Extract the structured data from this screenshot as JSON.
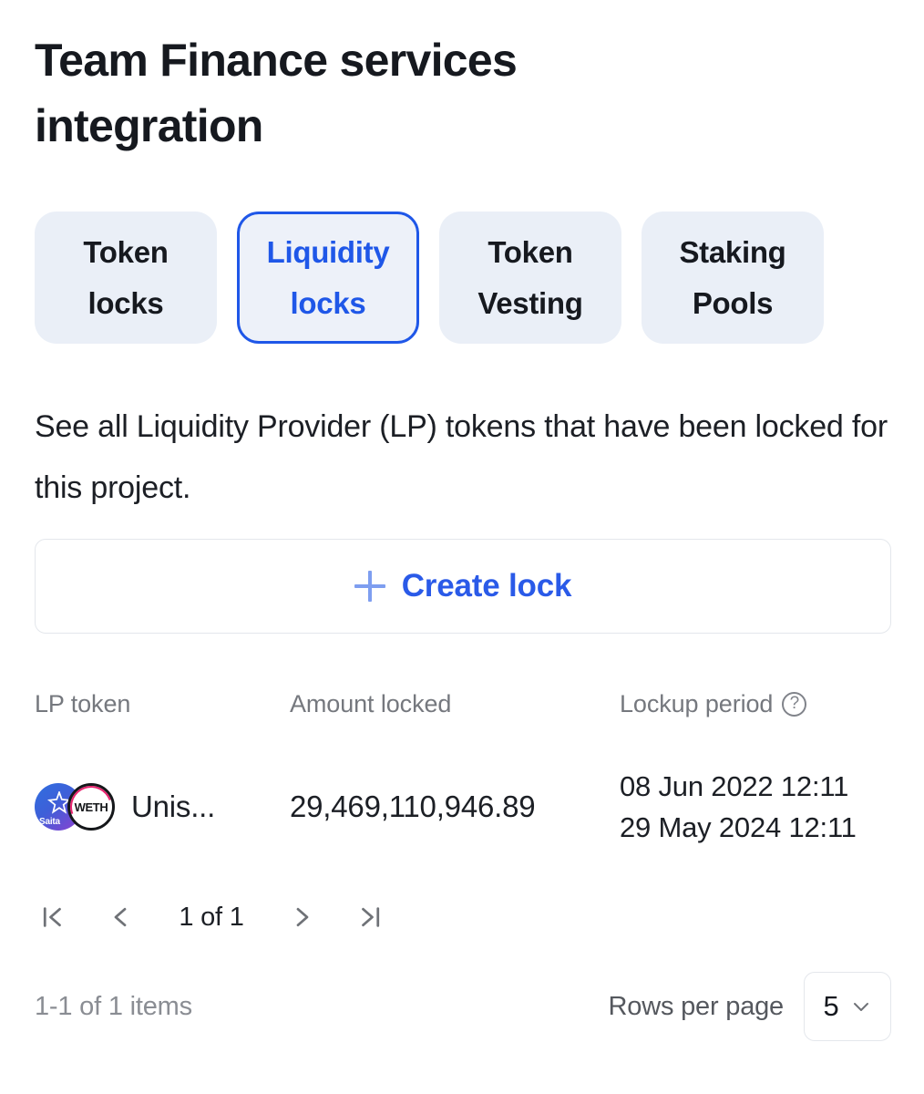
{
  "header": {
    "title": "Team Finance services integration"
  },
  "tabs": [
    {
      "label": "Token locks",
      "name": "tab-token-locks",
      "active": false
    },
    {
      "label": "Liquidity locks",
      "name": "tab-liquidity-locks",
      "active": true
    },
    {
      "label": "Token Vesting",
      "name": "tab-token-vesting",
      "active": false
    },
    {
      "label": "Staking Pools",
      "name": "tab-staking-pools",
      "active": false
    }
  ],
  "description": "See all Liquidity Provider (LP) tokens that have been locked for this project.",
  "actions": {
    "create_lock_label": "Create lock",
    "create_lock_icon": "plus-icon"
  },
  "table": {
    "columns": {
      "token": "LP token",
      "amount": "Amount locked",
      "period": "Lockup period"
    },
    "period_help_icon": "help-circle-icon",
    "period_help_glyph": "?",
    "rows": [
      {
        "token_name": "Unis...",
        "token_icon_1": "saita-token-icon",
        "token_icon_1_label": "Saita",
        "token_icon_2": "weth-token-icon",
        "token_icon_2_label": "WETH",
        "amount": "29,469,110,946.89",
        "period_start": "08 Jun 2022 12:11",
        "period_end": "29 May 2024 12:11"
      }
    ]
  },
  "pagination": {
    "first_icon": "first-page-icon",
    "prev_icon": "previous-page-icon",
    "status": "1 of 1",
    "next_icon": "next-page-icon",
    "last_icon": "last-page-icon"
  },
  "footer": {
    "items_count": "1-1 of 1 items",
    "rows_per_page_label": "Rows per page",
    "rows_per_page_value": "5",
    "rows_per_page_chevron": "chevron-down-icon"
  },
  "colors": {
    "accent_blue": "#1f57e8",
    "link_blue": "#2a5ae8",
    "plus_blue": "#7e9ef0",
    "tab_bg": "#eaeff7",
    "muted_gray": "#75787e",
    "text_dark": "#16191f"
  }
}
